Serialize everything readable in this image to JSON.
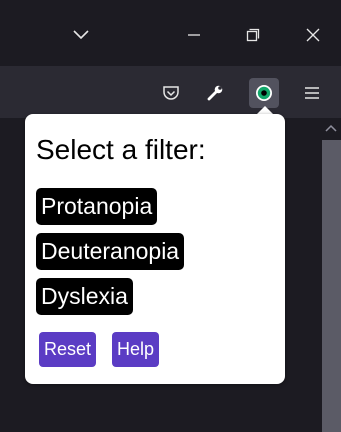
{
  "popup": {
    "title": "Select a filter:",
    "filters": [
      "Protanopia",
      "Deuteranopia",
      "Dyslexia"
    ],
    "reset_label": "Reset",
    "help_label": "Help"
  },
  "colors": {
    "filter_bg": "#000000",
    "button_bg": "#5b3cc4",
    "titlebar_bg": "#1c1b22",
    "toolbar_bg": "#2b2a33",
    "extension_icon": "#12a86b"
  },
  "icons": {
    "titlebar": [
      "chevron-down-icon",
      "minimize-icon",
      "restore-icon",
      "close-icon"
    ],
    "toolbar": [
      "pocket-icon",
      "wrench-icon",
      "color-filter-extension-icon",
      "hamburger-menu-icon"
    ]
  }
}
